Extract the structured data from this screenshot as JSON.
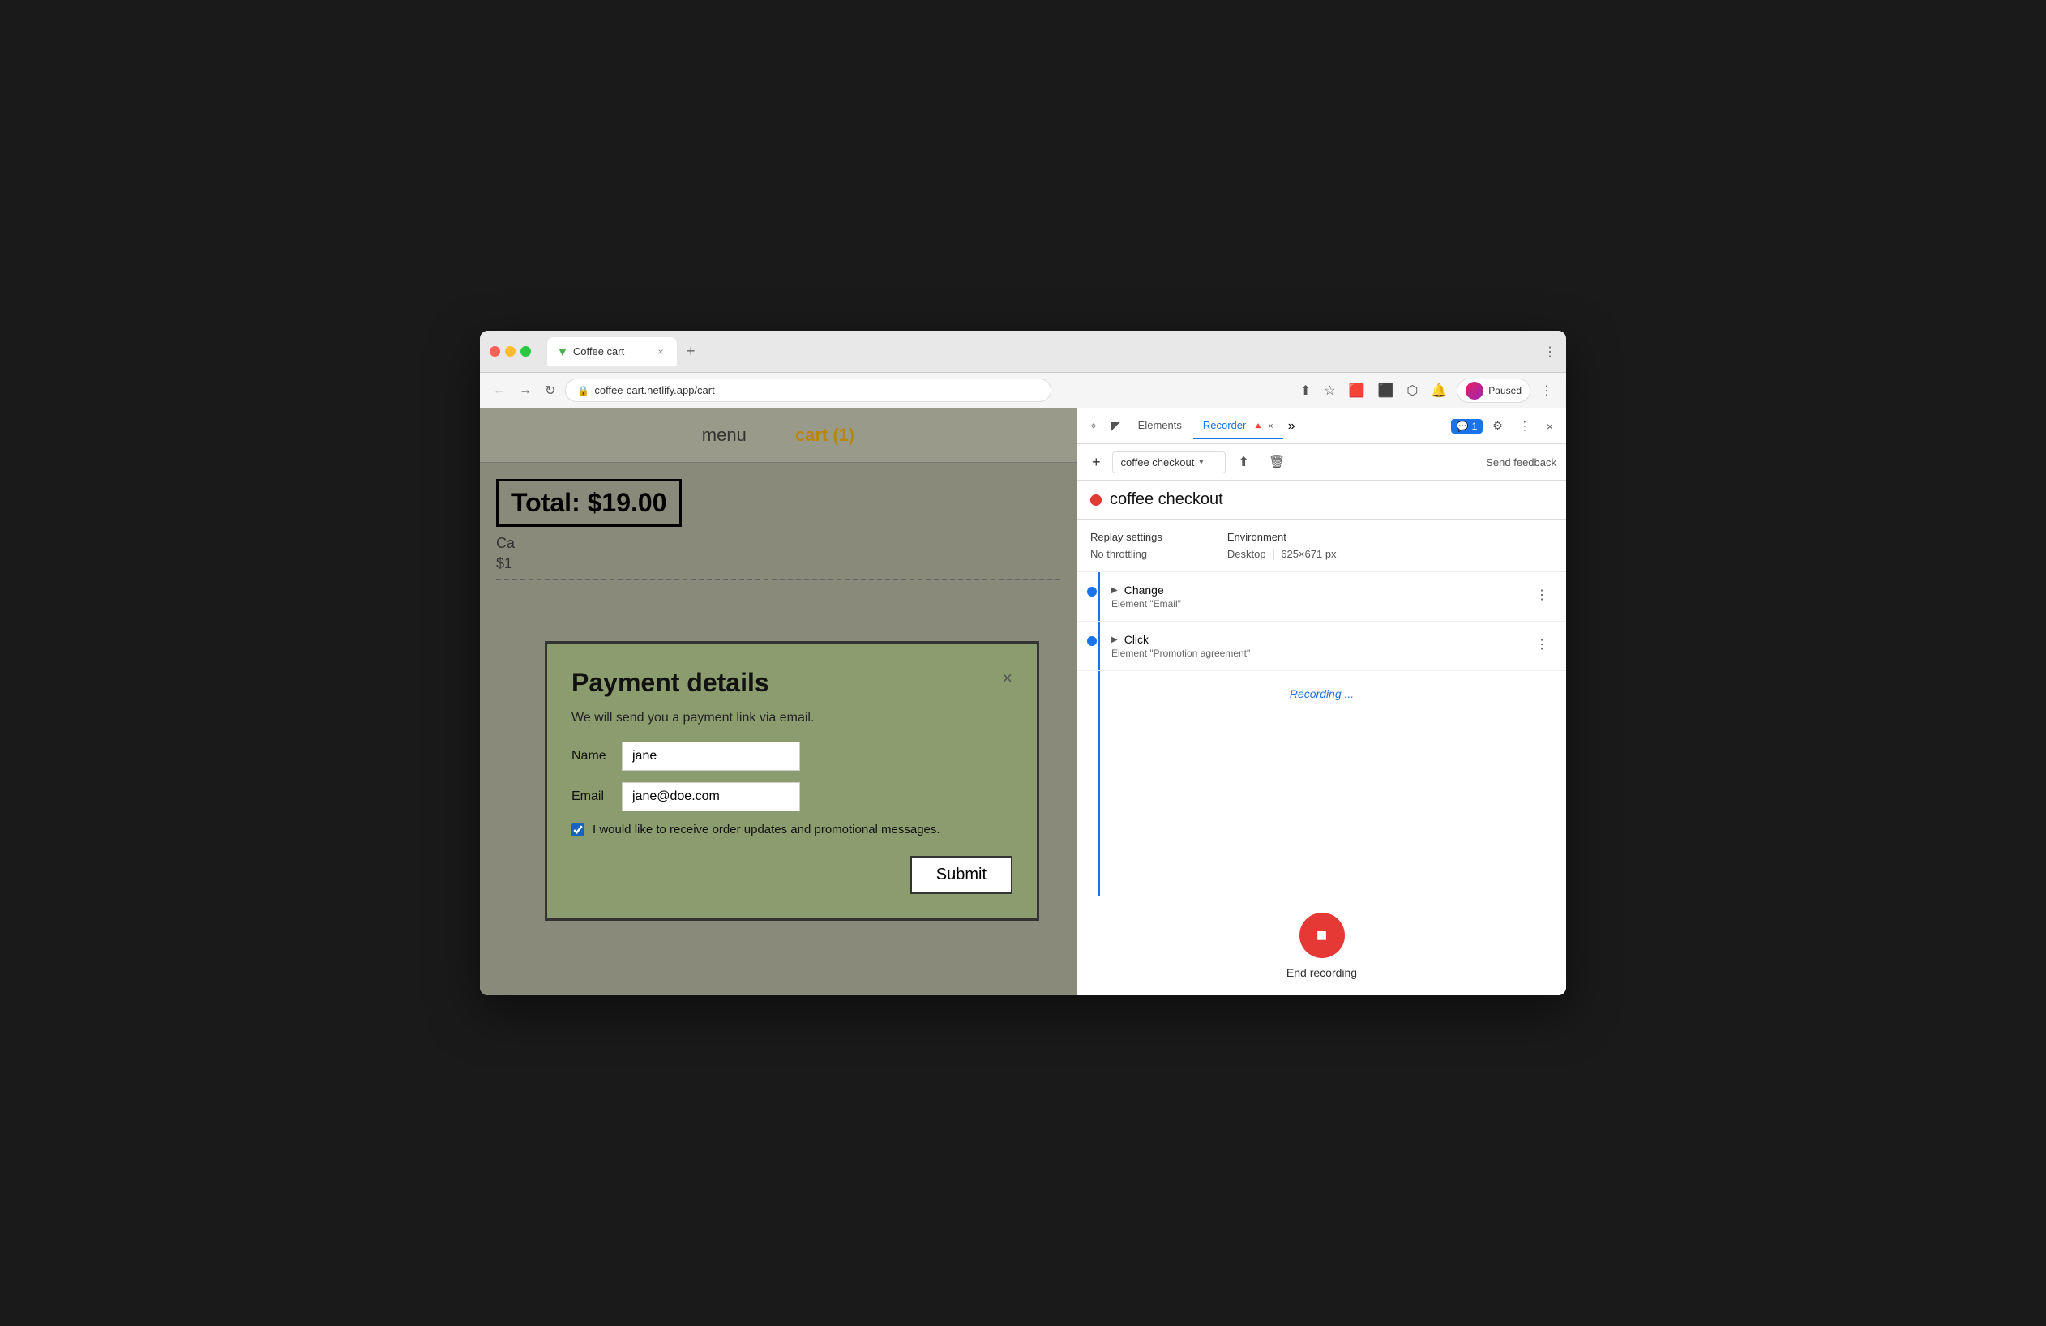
{
  "browser": {
    "traffic_lights": [
      "red",
      "yellow",
      "green"
    ],
    "tab": {
      "favicon": "▼",
      "title": "Coffee cart",
      "close_label": "×"
    },
    "new_tab_label": "+",
    "address": {
      "lock_icon": "🔒",
      "url": "coffee-cart.netlify.app/cart"
    },
    "toolbar": {
      "share_icon": "⬆",
      "star_icon": "☆",
      "ext1_icon": "🟥",
      "ext2_icon": "⬛",
      "ext3_icon": "⬡",
      "ext4_icon": "🔔",
      "paused_label": "Paused",
      "more_icon": "⋮"
    }
  },
  "website": {
    "nav": {
      "menu_label": "menu",
      "cart_label": "cart (1)"
    },
    "total": "Total: $19.00",
    "cart_item_label": "Ca",
    "cart_item_price": "$1",
    "modal": {
      "title": "Payment details",
      "close_label": "×",
      "description": "We will send you a payment link via email.",
      "name_label": "Name",
      "name_value": "jane",
      "email_label": "Email",
      "email_value": "jane@doe.com",
      "checkbox_label": "I would like to receive order updates and promotional messages.",
      "checkbox_checked": true,
      "submit_label": "Submit"
    }
  },
  "devtools": {
    "tabs": [
      {
        "label": "Elements",
        "active": false
      },
      {
        "label": "Recorder",
        "active": true
      },
      {
        "label": "🔺",
        "active": false
      }
    ],
    "more_icon": "»",
    "badge": {
      "icon": "💬",
      "count": "1"
    },
    "settings_icon": "⚙",
    "more_panel_icon": "⋮",
    "close_icon": "×",
    "recorder_toolbar": {
      "add_label": "+",
      "recording_name": "coffee checkout",
      "dropdown_arrow": "▾",
      "export_icon": "⬆",
      "delete_icon": "🗑",
      "send_feedback_label": "Send feedback"
    },
    "recording_title": "coffee checkout",
    "recording_dot_color": "#e53935",
    "replay_settings": {
      "heading": "Replay settings",
      "throttle_label": "No throttling",
      "environment_heading": "Environment",
      "environment_value": "Desktop",
      "dimensions": "625×671 px"
    },
    "steps": [
      {
        "type": "Change",
        "detail": "Element \"Email\"",
        "more_label": "⋮"
      },
      {
        "type": "Click",
        "detail": "Element \"Promotion agreement\"",
        "more_label": "⋮"
      }
    ],
    "recording_status": "Recording ...",
    "end_recording": {
      "stop_icon": "■",
      "label": "End recording"
    }
  }
}
